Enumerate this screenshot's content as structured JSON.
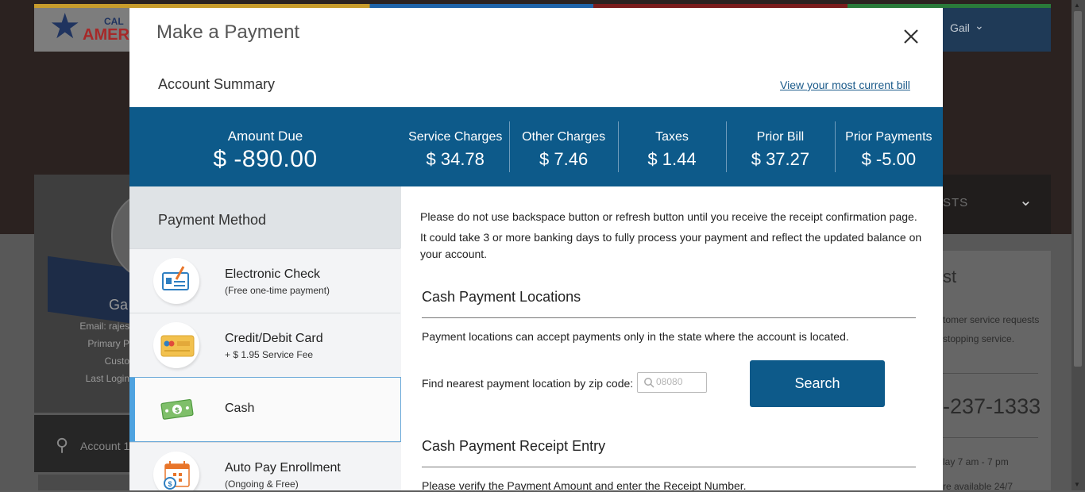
{
  "background": {
    "logo_top": "CAL",
    "logo_main": "AMERI",
    "user_name": "Gail",
    "profile_name": "Ga",
    "profile_lines": [
      "Email: rajes",
      "Primary P",
      "Custo",
      "Last Login"
    ],
    "account_label": "Account 1",
    "right_tab_text": "STS",
    "right_card_title": "st",
    "right_card_lines": [
      "tomer service requests",
      "stopping service."
    ],
    "right_phone": "-237-1333",
    "right_hours": "lay 7 am - 7 pm",
    "right_hours_2": "re available 24/7"
  },
  "modal": {
    "title": "Make a Payment",
    "account_summary": "Account Summary",
    "view_bill_link": "View your most current bill",
    "amount_due": {
      "label": "Amount Due",
      "value": "$ -890.00"
    },
    "charges": [
      {
        "label": "Service Charges",
        "value": "$ 34.78"
      },
      {
        "label": "Other Charges",
        "value": "$ 7.46"
      },
      {
        "label": "Taxes",
        "value": "$ 1.44"
      },
      {
        "label": "Prior Bill",
        "value": "$ 37.27"
      },
      {
        "label": "Prior Payments",
        "value": "$ -5.00"
      }
    ],
    "payment_method_title": "Payment Method",
    "methods": [
      {
        "name": "Electronic Check",
        "sub": "(Free one-time payment)",
        "icon": "check-icon"
      },
      {
        "name": "Credit/Debit Card",
        "sub": "+ $ 1.95 Service Fee",
        "icon": "credit-card-icon"
      },
      {
        "name": "Cash",
        "sub": "",
        "icon": "cash-icon",
        "active": true
      },
      {
        "name": "Auto Pay Enrollment",
        "sub": "(Ongoing & Free)",
        "icon": "calendar-icon"
      }
    ],
    "notice": [
      "Please do not use backspace button or refresh button until you receive the receipt confirmation page.",
      "It could take 3 or more banking days to fully process your payment and reflect the updated balance on your account."
    ],
    "cash_locations": {
      "title": "Cash Payment Locations",
      "text": "Payment locations can accept payments only in the state where the account is located.",
      "zip_label": "Find nearest payment location by zip code:",
      "zip_placeholder": "08080",
      "search_label": "Search"
    },
    "receipt_entry": {
      "title": "Cash Payment Receipt Entry",
      "text": "Please verify the Payment Amount and enter the Receipt Number."
    }
  },
  "colors": {
    "accent": "#0d5a8a",
    "active_bar": "#4fa3e0",
    "method_panel": "#f3f4f6",
    "method_header": "#dfe3e6"
  }
}
